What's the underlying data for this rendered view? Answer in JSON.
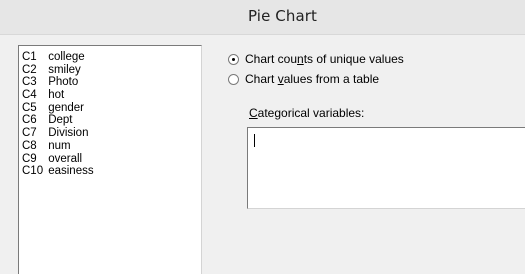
{
  "window": {
    "title": "Pie Chart"
  },
  "variables": [
    {
      "id": "C1",
      "name": "college"
    },
    {
      "id": "C2",
      "name": "smiley"
    },
    {
      "id": "C3",
      "name": "Photo"
    },
    {
      "id": "C4",
      "name": "hot"
    },
    {
      "id": "C5",
      "name": "gender"
    },
    {
      "id": "C6",
      "name": "Dept"
    },
    {
      "id": "C7",
      "name": "Division"
    },
    {
      "id": "C8",
      "name": "num"
    },
    {
      "id": "C9",
      "name": "overall"
    },
    {
      "id": "C10",
      "name": "easiness"
    }
  ],
  "options": {
    "count_unique": {
      "before": "Chart cou",
      "mnemonic": "n",
      "after": "ts of unique values",
      "selected": true
    },
    "values_table": {
      "before": "Chart ",
      "mnemonic": "v",
      "after": "alues from a table",
      "selected": false
    }
  },
  "categorical": {
    "mnemonic": "C",
    "label_rest": "ategorical variables:",
    "value": ""
  }
}
